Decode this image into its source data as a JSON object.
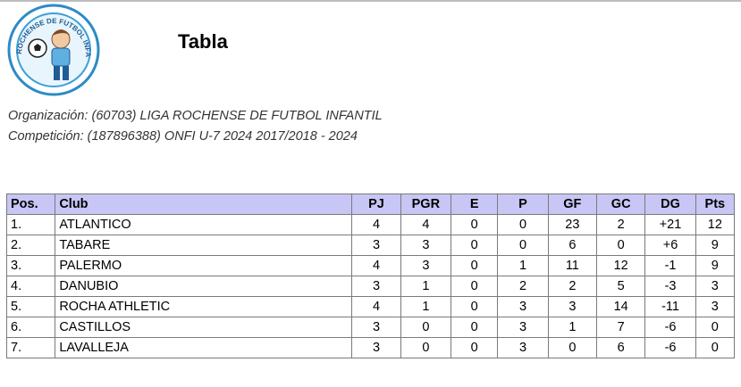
{
  "logo": {
    "top_text": "LIGA ROCHENSE DE",
    "side_text": "FUTBOL INFANTIL",
    "colors": {
      "ring": "#3aa0d8",
      "ball": "#222222",
      "shirt": "#5fb0e0"
    }
  },
  "title": "Tabla",
  "organization": "Organización: (60703) LIGA ROCHENSE DE FUTBOL INFANTIL",
  "competition": "Competición: (187896388) ONFI U-7 2024 2017/2018 - 2024",
  "table": {
    "headers": [
      "Pos.",
      "Club",
      "PJ",
      "PGR",
      "E",
      "P",
      "GF",
      "GC",
      "DG",
      "Pts"
    ],
    "rows": [
      [
        "1.",
        "ATLANTICO",
        "4",
        "4",
        "0",
        "0",
        "23",
        "2",
        "+21",
        "12"
      ],
      [
        "2.",
        "TABARE",
        "3",
        "3",
        "0",
        "0",
        "6",
        "0",
        "+6",
        "9"
      ],
      [
        "3.",
        "PALERMO",
        "4",
        "3",
        "0",
        "1",
        "11",
        "12",
        "-1",
        "9"
      ],
      [
        "4.",
        "DANUBIO",
        "3",
        "1",
        "0",
        "2",
        "2",
        "5",
        "-3",
        "3"
      ],
      [
        "5.",
        "ROCHA ATHLETIC",
        "4",
        "1",
        "0",
        "3",
        "3",
        "14",
        "-11",
        "3"
      ],
      [
        "6.",
        "CASTILLOS",
        "3",
        "0",
        "0",
        "3",
        "1",
        "7",
        "-6",
        "0"
      ],
      [
        "7.",
        "LAVALLEJA",
        "3",
        "0",
        "0",
        "3",
        "0",
        "6",
        "-6",
        "0"
      ]
    ],
    "header_bg": "#c8c6f5"
  }
}
